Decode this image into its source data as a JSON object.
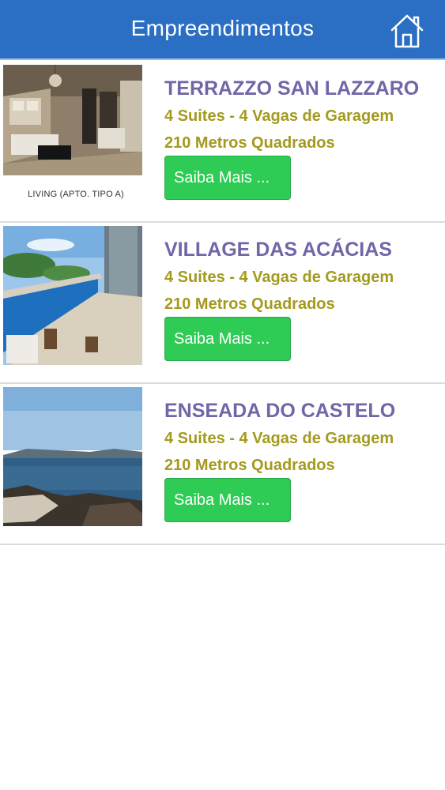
{
  "header": {
    "title": "Empreendimentos",
    "home_icon": "home-icon",
    "background_color": "#2b6fc4"
  },
  "listings": [
    {
      "name": "TERRAZZO SAN LAZZARO",
      "suites": "4 Suites - 4 Vagas de Garagem",
      "area": "210 Metros Quadrados",
      "button_label": "Saiba Mais ...",
      "image_caption": "LIVING (APTO. TIPO A)"
    },
    {
      "name": "VILLAGE DAS ACÁCIAS",
      "suites": "4 Suites - 4 Vagas de Garagem",
      "area": "210 Metros Quadrados",
      "button_label": "Saiba Mais ..."
    },
    {
      "name": "ENSEADA DO CASTELO",
      "suites": "4 Suites - 4 Vagas de Garagem",
      "area": "210 Metros Quadrados",
      "button_label": "Saiba Mais ..."
    }
  ],
  "colors": {
    "name": "#7066a8",
    "details": "#a39a1e",
    "button": "#2ecb55"
  }
}
